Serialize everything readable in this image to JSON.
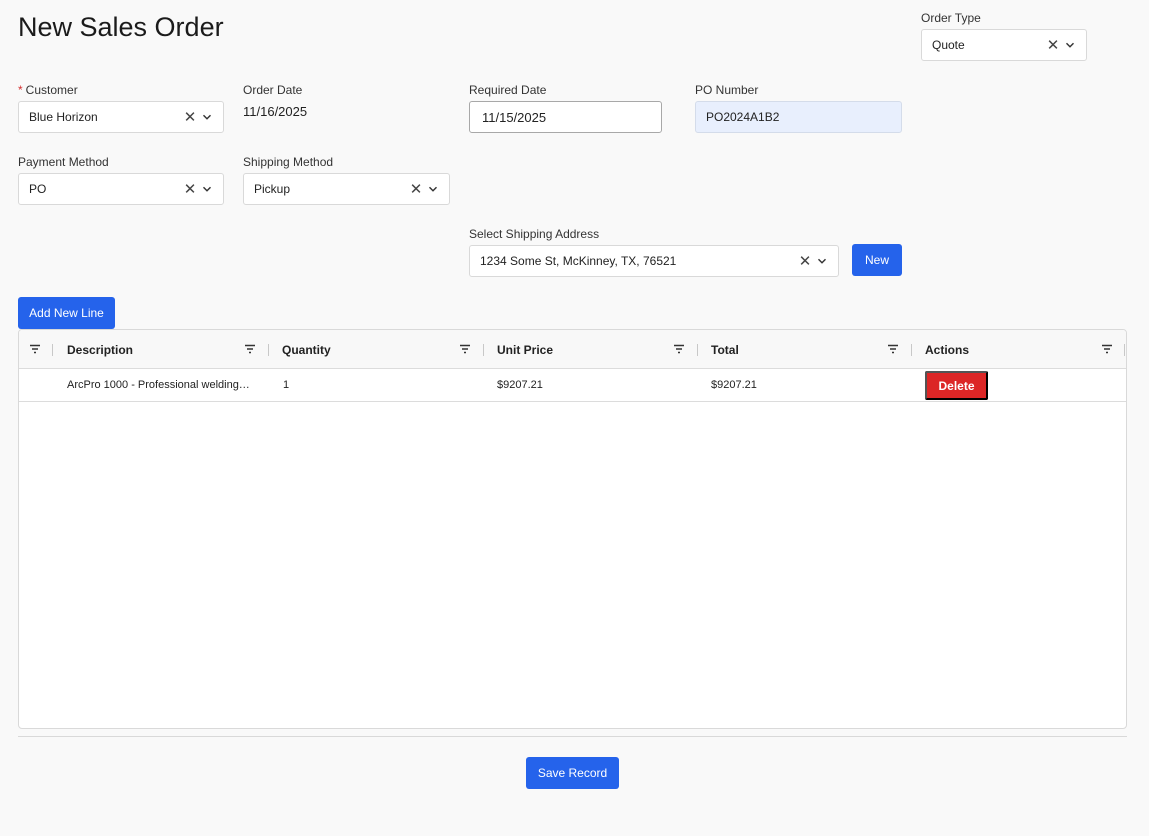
{
  "page": {
    "title": "New Sales Order"
  },
  "order_type": {
    "label": "Order Type",
    "value": "Quote"
  },
  "customer": {
    "label": "Customer",
    "required_mark": "*",
    "value": "Blue Horizon"
  },
  "order_date": {
    "label": "Order Date",
    "value": "11/16/2025"
  },
  "required_date": {
    "label": "Required Date",
    "value": "11/15/2025"
  },
  "po_number": {
    "label": "PO Number",
    "value": "PO2024A1B2"
  },
  "payment_method": {
    "label": "Payment Method",
    "value": "PO"
  },
  "shipping_method": {
    "label": "Shipping Method",
    "value": "Pickup"
  },
  "shipping_address": {
    "label": "Select Shipping Address",
    "value": "1234 Some St, McKinney, TX, 76521",
    "new_button": "New"
  },
  "lines": {
    "add_button": "Add New Line",
    "columns": [
      "Description",
      "Quantity",
      "Unit Price",
      "Total",
      "Actions"
    ],
    "rows": [
      {
        "description": "ArcPro 1000 - Professional welding…",
        "quantity": "1",
        "unit_price": "$9207.21",
        "total": "$9207.21",
        "action": "Delete"
      }
    ]
  },
  "footer": {
    "save_button": "Save Record"
  },
  "icons": {
    "clear": "close-icon",
    "dropdown": "chevron-down-icon",
    "filter": "filter-icon"
  },
  "colors": {
    "primary": "#2563eb",
    "danger": "#dc2626",
    "required": "#d32f2f",
    "po_fill": "#e8effd"
  }
}
